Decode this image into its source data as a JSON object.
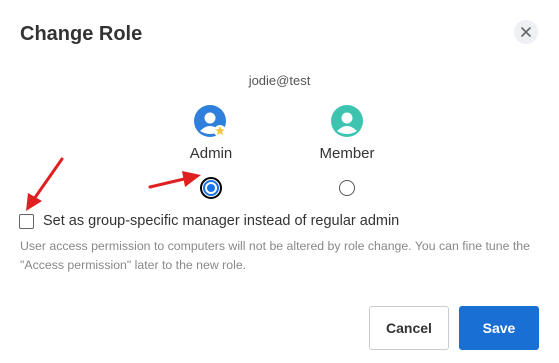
{
  "dialog": {
    "title": "Change Role",
    "close_icon": "close-icon"
  },
  "user": {
    "email": "jodie@test"
  },
  "roles": [
    {
      "label": "Admin",
      "icon": "admin-user-icon",
      "selected": true
    },
    {
      "label": "Member",
      "icon": "member-user-icon",
      "selected": false
    }
  ],
  "group_manager": {
    "label": "Set as group-specific manager instead of regular admin",
    "checked": false
  },
  "help_text": "User access permission to computers will not be altered by role change. You can fine tune the \"Access permission\" later to the new role.",
  "buttons": {
    "cancel_label": "Cancel",
    "save_label": "Save"
  },
  "colors": {
    "accent": "#1a6fd4",
    "admin_avatar": "#2f7fdc",
    "member_avatar": "#3cc4b0",
    "admin_badge": "#f5c542",
    "annotation_arrow": "#e02020"
  },
  "annotations": [
    "arrow-pointing-to-checkbox",
    "arrow-pointing-to-admin-radio"
  ]
}
